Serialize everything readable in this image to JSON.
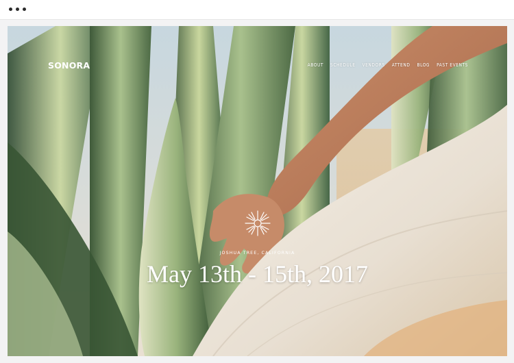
{
  "window": {
    "controls": [
      "dot",
      "dot",
      "dot"
    ]
  },
  "site": {
    "logo": "SONORA",
    "nav": [
      "ABOUT",
      "SCHEDULE",
      "VENDORS",
      "ATTEND",
      "BLOG",
      "PAST EVENTS"
    ]
  },
  "hero": {
    "emblem": "sunburst-icon",
    "location": "JOSHUA TREE, CALIFORNIA",
    "dates": "May 13th - 15th, 2017"
  }
}
